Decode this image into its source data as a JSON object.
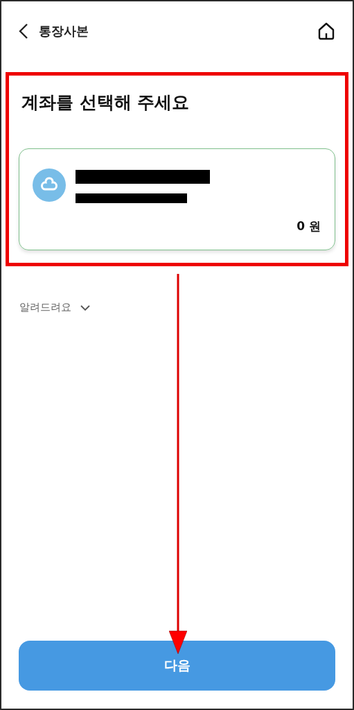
{
  "header": {
    "title": "통장사본"
  },
  "heading": "계좌를 선택해 주세요",
  "account": {
    "balance": "0 원",
    "selected": true
  },
  "notice": {
    "label": "알려드려요",
    "expanded": false
  },
  "button": {
    "label": "다음"
  }
}
